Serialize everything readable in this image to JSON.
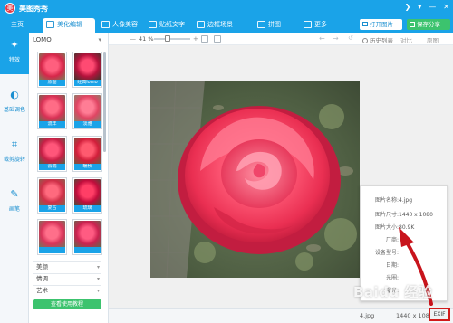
{
  "app": {
    "title": "美图秀秀",
    "logo_text": "美"
  },
  "window_controls": [
    "❯",
    "▾",
    "—",
    "✕"
  ],
  "tabs": [
    {
      "label": "主页"
    },
    {
      "label": "美化编辑"
    },
    {
      "label": "人像美容"
    },
    {
      "label": "贴纸文字"
    },
    {
      "label": "边框场景"
    },
    {
      "label": "拼图"
    },
    {
      "label": "更多"
    }
  ],
  "header_buttons": {
    "open": "打开图片",
    "save": "保存分享"
  },
  "left_rail": [
    {
      "label": "特效",
      "icon": "magic-wand-icon",
      "glyph": "✦"
    },
    {
      "label": "基础调色",
      "icon": "palette-icon",
      "glyph": "◐"
    },
    {
      "label": "裁剪旋转",
      "icon": "crop-icon",
      "glyph": "⌗"
    },
    {
      "label": "画笔",
      "icon": "brush-icon",
      "glyph": "✎"
    }
  ],
  "effects": {
    "category": "LOMO",
    "thumbnails": [
      {
        "label": "原图"
      },
      {
        "label": "经典lomo"
      },
      {
        "label": "流年"
      },
      {
        "label": "淡雅"
      },
      {
        "label": "云端"
      },
      {
        "label": "暖秋"
      },
      {
        "label": "复古"
      },
      {
        "label": "琉璃"
      },
      {
        "label": ""
      },
      {
        "label": ""
      }
    ],
    "categories": [
      "美颜",
      "情调",
      "艺术"
    ],
    "tutorial_button": "查看使用教程"
  },
  "toolbar": {
    "zoom": "41 %",
    "history": "历史列表",
    "compare": "对比",
    "original": "原图"
  },
  "photo_info": {
    "rows": [
      {
        "key": "图片名称:",
        "value": "4.jpg"
      },
      {
        "key": "图片尺寸:",
        "value": "1440 x 1080"
      },
      {
        "key": "图片大小:",
        "value": "80.9K"
      },
      {
        "key": "厂商:",
        "value": ""
      },
      {
        "key": "设备型号:",
        "value": ""
      },
      {
        "key": "日期:",
        "value": ""
      },
      {
        "key": "光圈:",
        "value": ""
      },
      {
        "key": "曝光:",
        "value": ""
      }
    ]
  },
  "status": {
    "filename": "4.jpg",
    "dimensions": "1440 x 1080",
    "exif_button": "EXIF"
  },
  "watermark": "Baidu 经验",
  "colors": {
    "brand": "#1aa3e8",
    "save": "#3cc36e",
    "highlight": "#d11a1a"
  }
}
